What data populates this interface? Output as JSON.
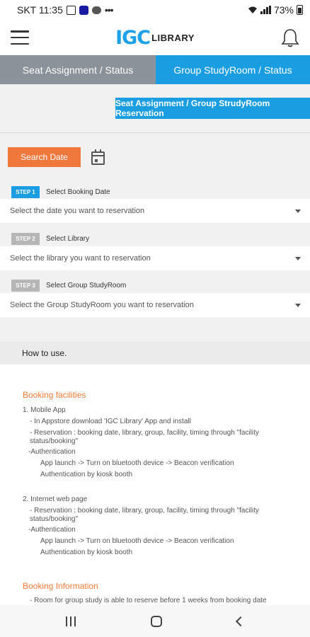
{
  "statusbar": {
    "carrier_time": "SKT 11:35",
    "battery": "73%"
  },
  "header": {
    "logo_mark": "IGC",
    "logo_text": "LIBRARY"
  },
  "tabs": [
    {
      "label": "Seat Assignment / Status"
    },
    {
      "label": "Group StudyRoom / Status"
    }
  ],
  "reservation_button": "Seat Assignment / Group StrudyRoom Reservation",
  "search_button": "Search Date",
  "steps": [
    {
      "badge": "STEP 1",
      "label": "Select Booking Date",
      "select": "Select the date you want to reservation",
      "active": true
    },
    {
      "badge": "STEP 2",
      "label": "Select Library",
      "select": "Select the library you want to reservation",
      "active": false
    },
    {
      "badge": "STEP 3",
      "label": "Select Group StudyRoom",
      "select": "Select the Group StudyRoom you want to reservation",
      "active": false
    }
  ],
  "howto": {
    "title": "How to use.",
    "booking_facilities": "Booking facilities",
    "mobile_app": "1. Mobile App",
    "mobile_download": "- In Appstore download 'IGC Library' App and install",
    "mobile_reservation_1": "- Reservation : booking date, library, group, facility, timing through \"facility",
    "mobile_reservation_2": "status/booking\"",
    "mobile_auth": "-Authentication",
    "mobile_auth_1": "App launch -> Turn on bluetooth device -> Beacon verification",
    "mobile_auth_2": "Authentication by kiosk booth",
    "web_page": "2. Internet web page",
    "web_reservation_1": "- Reservation : booking date, library, group, facility, timing through \"facility",
    "web_reservation_2": "status/booking\"",
    "web_auth": "-Authentication",
    "web_auth_1": "App launch -> Turn on bluetooth device -> Beacon verification",
    "web_auth_2": "Authentication by kiosk booth",
    "booking_information": "Booking Information",
    "info_1": "- Room for group study is able to reserve before 1 weeks from booking date"
  },
  "colors": {
    "accent_blue": "#1a9de1",
    "accent_orange": "#f1783c",
    "tab_gray": "#8b9299"
  },
  "icons": {
    "menu": "hamburger-icon",
    "notification": "bell-icon",
    "calendar": "calendar-icon"
  }
}
